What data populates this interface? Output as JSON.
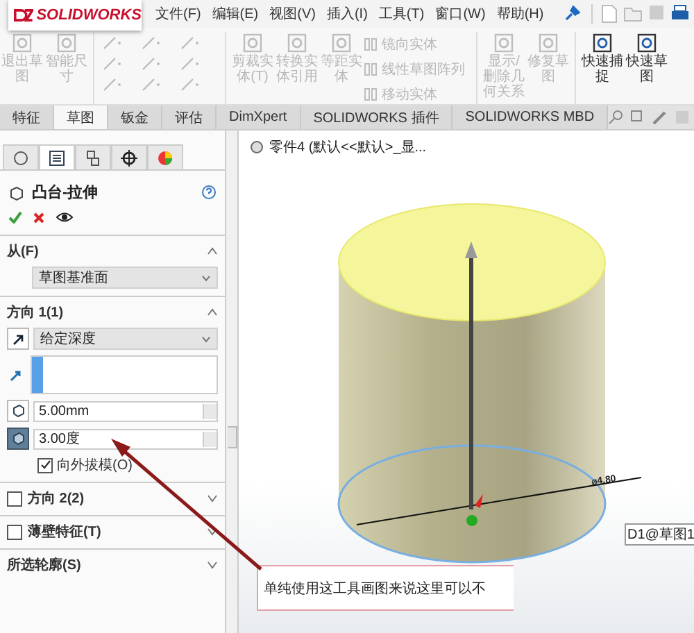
{
  "app": {
    "logo": "SOLIDWORKS"
  },
  "menu": [
    "文件(F)",
    "编辑(E)",
    "视图(V)",
    "插入(I)",
    "工具(T)",
    "窗口(W)",
    "帮助(H)"
  ],
  "ribbon": {
    "left": [
      {
        "label": "退出草图",
        "disabled": true
      },
      {
        "label": "智能尺寸",
        "disabled": true
      }
    ],
    "middle": [
      {
        "label": "剪裁实体(T)",
        "disabled": true
      },
      {
        "label": "转换实体引用",
        "disabled": true
      },
      {
        "label": "等距实体",
        "disabled": true
      }
    ],
    "stack": [
      {
        "label": "镜向实体",
        "disabled": true
      },
      {
        "label": "线性草图阵列",
        "disabled": true
      },
      {
        "label": "移动实体",
        "disabled": true
      }
    ],
    "right": [
      {
        "label": "显示/删除几何关系",
        "disabled": true
      },
      {
        "label": "修复草图",
        "disabled": true
      },
      {
        "label": "快速捕捉",
        "disabled": false
      },
      {
        "label": "快速草图",
        "disabled": false
      }
    ]
  },
  "tabs": [
    {
      "label": "特征",
      "selected": false
    },
    {
      "label": "草图",
      "selected": true
    },
    {
      "label": "钣金",
      "selected": false
    },
    {
      "label": "评估",
      "selected": false
    },
    {
      "label": "DimXpert",
      "selected": false
    },
    {
      "label": "SOLIDWORKS 插件",
      "selected": false
    },
    {
      "label": "SOLIDWORKS MBD",
      "selected": false
    }
  ],
  "panel": {
    "tabs": [
      {
        "kind": "feature",
        "selected": false
      },
      {
        "kind": "property",
        "selected": true
      },
      {
        "kind": "config",
        "selected": false
      },
      {
        "kind": "target",
        "selected": false
      },
      {
        "kind": "appearance",
        "selected": false
      }
    ],
    "title": "凸台-拉伸",
    "sections": [
      {
        "kind": "plain",
        "title": "从(F)",
        "expanded": true,
        "fields": [
          {
            "kind": "dropdown",
            "value": "草图基准面"
          }
        ]
      },
      {
        "kind": "plain",
        "title": "方向 1(1)",
        "expanded": true,
        "fields": [
          {
            "kind": "dropdown",
            "value": "给定深度"
          },
          {
            "kind": "selection"
          },
          {
            "kind": "spinner",
            "value": "5.00mm",
            "pressed": false
          },
          {
            "kind": "spinner",
            "value": "3.00度",
            "pressed": true
          },
          {
            "kind": "checkbox",
            "label": "向外拔模(O)",
            "checked": true
          }
        ]
      },
      {
        "kind": "checkbox",
        "title": "方向 2(2)",
        "checked": false,
        "expanded": false
      },
      {
        "kind": "checkbox",
        "title": "薄壁特征(T)",
        "checked": false,
        "expanded": false
      },
      {
        "kind": "plain",
        "title": "所选轮廓(S)",
        "expanded": false
      }
    ]
  },
  "viewport": {
    "breadcrumb": "零件4 (默认<<默认>_显...",
    "dimension": "⌀4.80",
    "tag": "D1@草图1"
  },
  "callout": "单纯使用这工具画图来说这里可以不"
}
